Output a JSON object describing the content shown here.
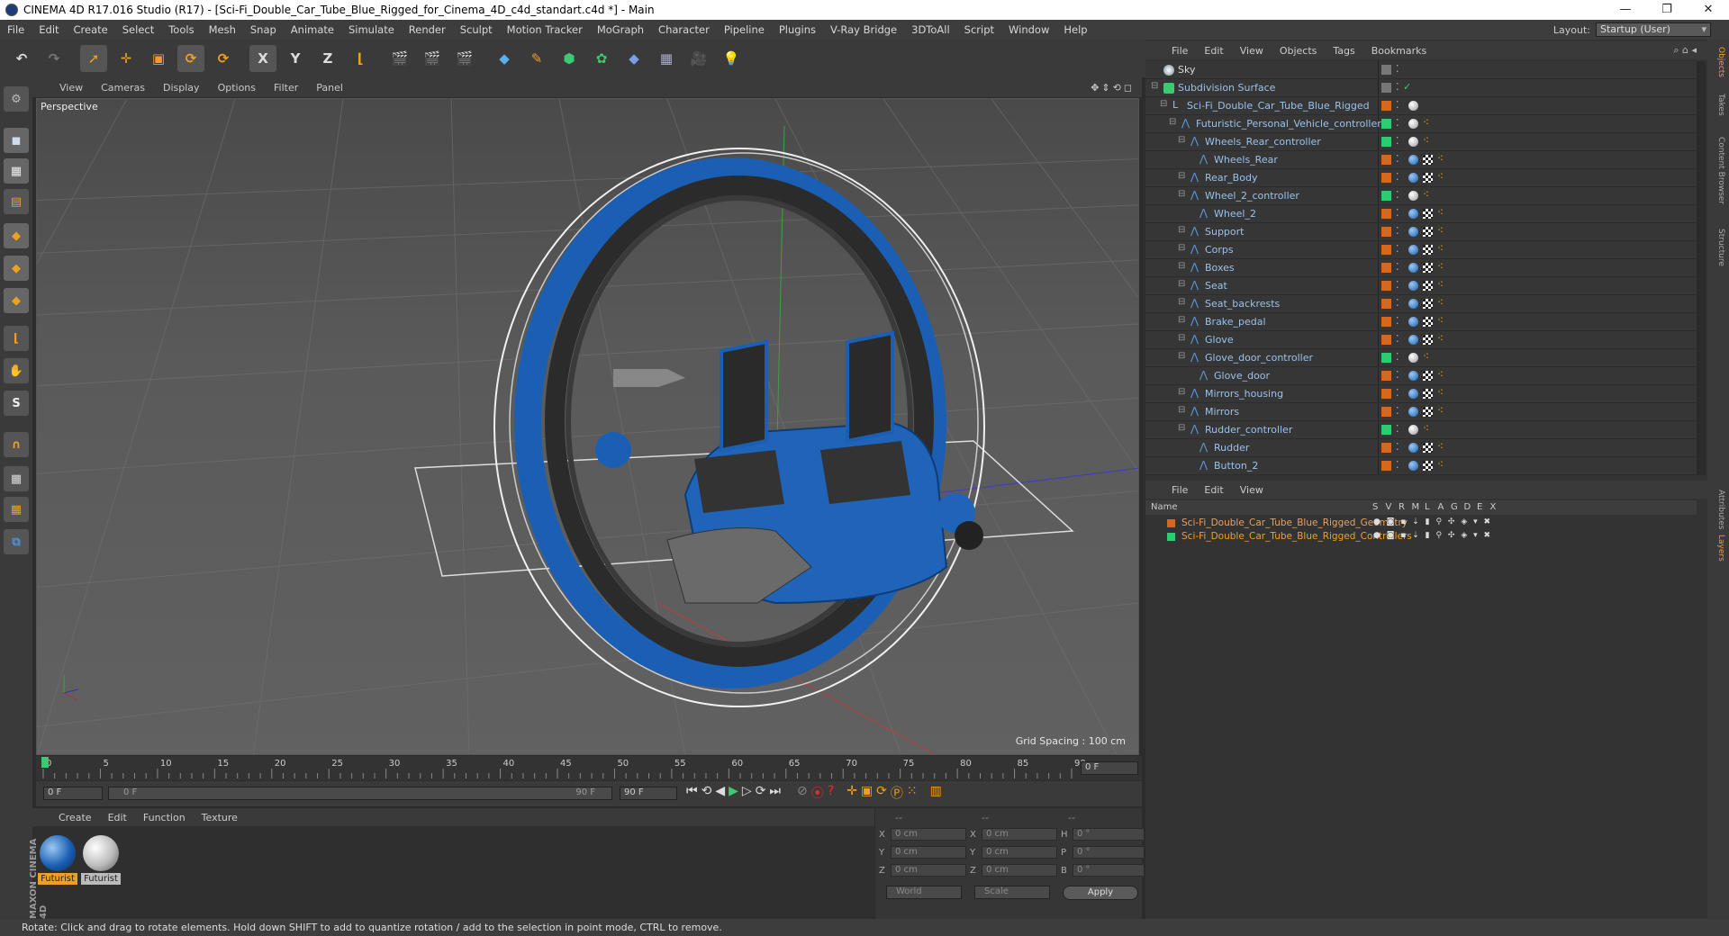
{
  "window": {
    "title": "CINEMA 4D R17.016 Studio (R17) - [Sci-Fi_Double_Car_Tube_Blue_Rigged_for_Cinema_4D_c4d_standart.c4d *] - Main",
    "min": "—",
    "max": "❐",
    "close": "✕"
  },
  "menubar": [
    "File",
    "Edit",
    "Create",
    "Select",
    "Tools",
    "Mesh",
    "Snap",
    "Animate",
    "Simulate",
    "Render",
    "Sculpt",
    "Motion Tracker",
    "MoGraph",
    "Character",
    "Pipeline",
    "Plugins",
    "V-Ray Bridge",
    "3DToAll",
    "Script",
    "Window",
    "Help"
  ],
  "layout": {
    "label": "Layout:",
    "value": "Startup (User)"
  },
  "toolbar": {
    "x": "X",
    "y": "Y",
    "z": "Z"
  },
  "viewport": {
    "menu": [
      "View",
      "Cameras",
      "Display",
      "Options",
      "Filter",
      "Panel"
    ],
    "icons": "✥⇕⟲◻",
    "label": "Perspective",
    "grid_spacing": "Grid Spacing : 100 cm"
  },
  "timeline": {
    "ticks": [
      "0",
      "5",
      "10",
      "15",
      "20",
      "25",
      "30",
      "35",
      "40",
      "45",
      "50",
      "55",
      "60",
      "65",
      "70",
      "75",
      "80",
      "85",
      "90"
    ],
    "frame_field": "0 F",
    "start": "0 F",
    "range_start": "0 F",
    "range_end": "90 F",
    "end": "90 F"
  },
  "materials": {
    "menu": [
      "Create",
      "Edit",
      "Function",
      "Texture"
    ],
    "items": [
      {
        "name": "Futurist"
      },
      {
        "name": "Futurist"
      }
    ]
  },
  "coords": {
    "headers": [
      "--",
      "--",
      "--"
    ],
    "rows": [
      {
        "a": "X",
        "av": "0 cm",
        "b": "X",
        "bv": "0 cm",
        "c": "H",
        "cv": "0 °"
      },
      {
        "a": "Y",
        "av": "0 cm",
        "b": "Y",
        "bv": "0 cm",
        "c": "P",
        "cv": "0 °"
      },
      {
        "a": "Z",
        "av": "0 cm",
        "b": "Z",
        "bv": "0 cm",
        "c": "B",
        "cv": "0 °"
      }
    ],
    "mode1": "World",
    "mode2": "Scale",
    "apply": "Apply"
  },
  "status": "Rotate: Click and drag to rotate elements. Hold down SHIFT to add to quantize rotation / add to the selection in point mode, CTRL to remove.",
  "objects": {
    "menu": [
      "File",
      "Edit",
      "View",
      "Objects",
      "Tags",
      "Bookmarks"
    ],
    "items": [
      {
        "name": "Sky",
        "indent": 0,
        "type": "sky",
        "white": true
      },
      {
        "name": "Subdivision Surface",
        "indent": 0,
        "type": "subd",
        "white": false
      },
      {
        "name": "Sci-Fi_Double_Car_Tube_Blue_Rigged",
        "indent": 1,
        "type": "null",
        "white": false
      },
      {
        "name": "Futuristic_Personal_Vehicle_controller",
        "indent": 2,
        "type": "bone",
        "white": false
      },
      {
        "name": "Wheels_Rear_controller",
        "indent": 3,
        "type": "bone",
        "white": false
      },
      {
        "name": "Wheels_Rear",
        "indent": 4,
        "type": "bone",
        "white": false
      },
      {
        "name": "Rear_Body",
        "indent": 3,
        "type": "bone",
        "white": false
      },
      {
        "name": "Wheel_2_controller",
        "indent": 3,
        "type": "bone",
        "white": false
      },
      {
        "name": "Wheel_2",
        "indent": 4,
        "type": "bone",
        "white": false
      },
      {
        "name": "Support",
        "indent": 3,
        "type": "bone",
        "white": false
      },
      {
        "name": "Corps",
        "indent": 3,
        "type": "bone",
        "white": false
      },
      {
        "name": "Boxes",
        "indent": 3,
        "type": "bone",
        "white": false
      },
      {
        "name": "Seat",
        "indent": 3,
        "type": "bone",
        "white": false
      },
      {
        "name": "Seat_backrests",
        "indent": 3,
        "type": "bone",
        "white": false
      },
      {
        "name": "Brake_pedal",
        "indent": 3,
        "type": "bone",
        "white": false
      },
      {
        "name": "Glove",
        "indent": 3,
        "type": "bone",
        "white": false
      },
      {
        "name": "Glove_door_controller",
        "indent": 3,
        "type": "bone",
        "white": false
      },
      {
        "name": "Glove_door",
        "indent": 4,
        "type": "bone",
        "white": false
      },
      {
        "name": "Mirrors_housing",
        "indent": 3,
        "type": "bone",
        "white": false
      },
      {
        "name": "Mirrors",
        "indent": 3,
        "type": "bone",
        "white": false
      },
      {
        "name": "Rudder_controller",
        "indent": 3,
        "type": "bone",
        "white": false
      },
      {
        "name": "Rudder",
        "indent": 4,
        "type": "bone",
        "white": false
      },
      {
        "name": "Button_2",
        "indent": 4,
        "type": "bone",
        "white": false
      }
    ]
  },
  "layers": {
    "menu": [
      "File",
      "Edit",
      "View"
    ],
    "headers": {
      "name": "Name",
      "cols": [
        "S",
        "V",
        "R",
        "M",
        "L",
        "A",
        "G",
        "D",
        "E",
        "X"
      ]
    },
    "items": [
      {
        "name": "Sci-Fi_Double_Car_Tube_Blue_Rigged_Geometry",
        "color": "#d2691e",
        "text_color": "#e8a060"
      },
      {
        "name": "Sci-Fi_Double_Car_Tube_Blue_Rigged_Controllers",
        "color": "#2ecc71",
        "text_color": "#f0a020"
      }
    ]
  },
  "sidetabs": [
    "Objects",
    "Takes",
    "Content Browser",
    "Structure",
    "Attributes",
    "Layers"
  ],
  "colors": {
    "accent": "#f0a020",
    "blue": "#1a5fb4",
    "bone": "#5ea0e6"
  }
}
